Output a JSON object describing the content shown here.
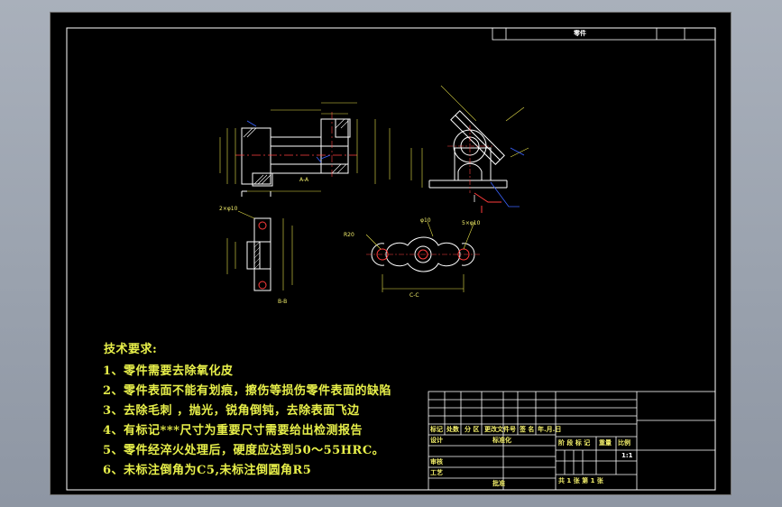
{
  "tech": {
    "title": "技术要求:",
    "items": [
      "1、零件需要去除氧化皮",
      "2、零件表面不能有划痕，擦伤等损伤零件表面的缺陷",
      "3、去除毛刺 ，抛光，锐角倒钝，去除表面飞边",
      "4、有标记***尺寸为重要尺寸需要给出检测报告",
      "5、零件经淬火处理后，硬度应达到50～55HRC。",
      "6、未标注倒角为C5,未标注倒圆角R5"
    ]
  },
  "title_block": {
    "row1": [
      "标记",
      "处数",
      "分 区",
      "更改文件号",
      "签 名",
      "年.月.日"
    ],
    "design": "设计",
    "standard": "标准化",
    "stage": "阶 段 标 记",
    "weight": "重量",
    "scale_label": "比例",
    "scale": "1:1",
    "review": "审核",
    "process": "工艺",
    "approve": "批准",
    "sheets": "共  1  张    第  1  张"
  },
  "top_strip": [
    "零件"
  ],
  "view_labels": {
    "a": "A-A",
    "b": "B-B",
    "c": "C-C"
  },
  "dims": {
    "c_note": "2×φ10",
    "r_note": "5×φ10",
    "d_label": "φ10",
    "r_label": "R20"
  },
  "colors": {
    "outline": "#ffffff",
    "dimension": "#e8e24a",
    "cut": "#ff3b3b",
    "leader": "#3a63ff",
    "centerline": "#ff4040",
    "frame": "#ffffff"
  }
}
